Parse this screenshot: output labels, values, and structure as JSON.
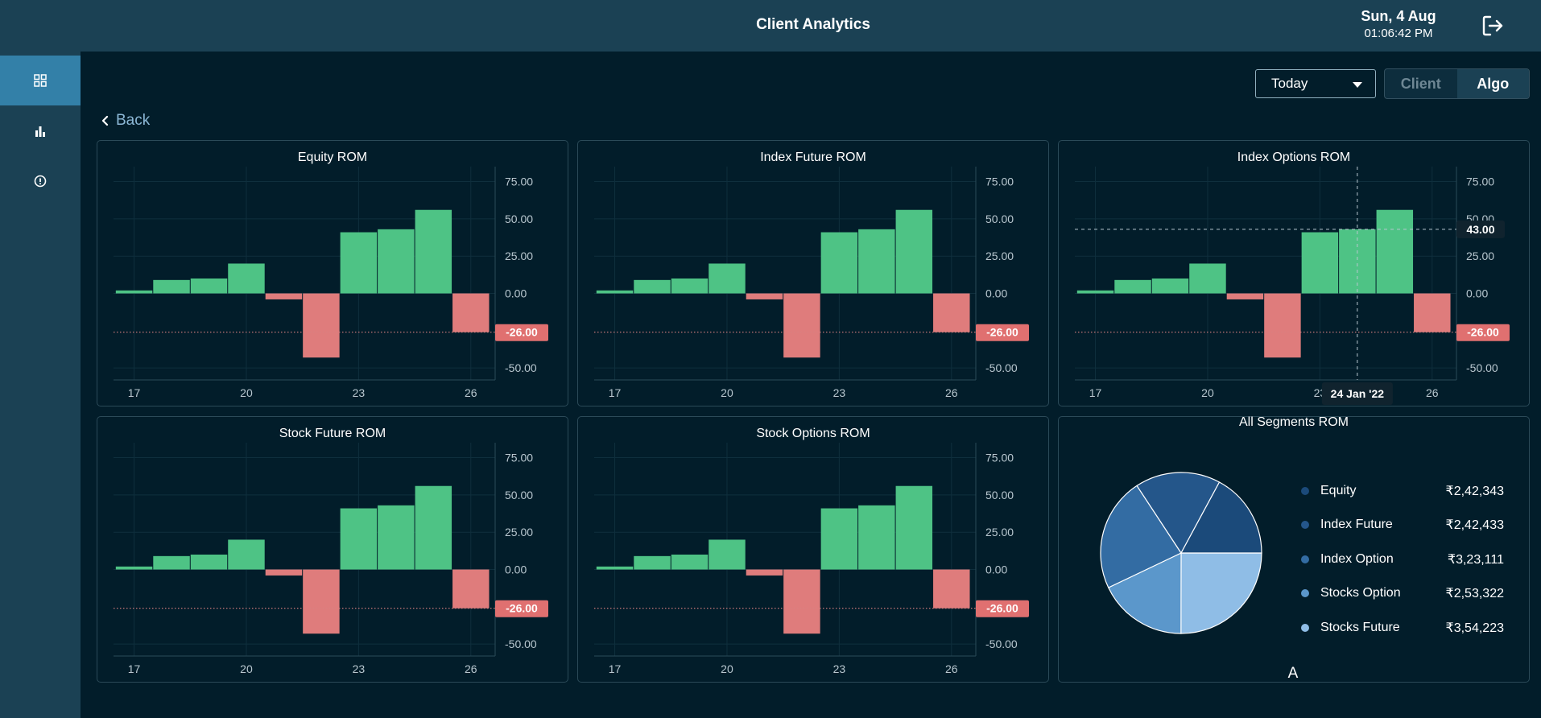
{
  "header": {
    "title": "Client Analytics",
    "date": "Sun, 4 Aug",
    "time": "01:06:42 PM"
  },
  "icons": {
    "logout": "logout-icon",
    "dashboard": "grid-icon",
    "reports": "bar-chart-icon",
    "info": "info-circle-icon",
    "back": "chevron-left-icon",
    "dropdown": "caret-down-icon"
  },
  "sidebar": {
    "items": [
      {
        "name": "dashboard",
        "active": true
      },
      {
        "name": "reports",
        "active": false
      },
      {
        "name": "info",
        "active": false
      }
    ]
  },
  "filters": {
    "period": "Today",
    "toggle": {
      "options": [
        "Client",
        "Algo"
      ],
      "selected": "Algo"
    }
  },
  "nav": {
    "back_label": "Back"
  },
  "colors": {
    "positive": "#4ec385",
    "negative": "#df7c7c",
    "reference_label_bg": "#e07070",
    "grid": "#0f2f3d"
  },
  "chart_data": [
    {
      "type": "bar",
      "title": "Equity ROM",
      "x": [
        17,
        18,
        19,
        20,
        21,
        22,
        23,
        24,
        25,
        26
      ],
      "values": [
        2,
        9,
        10,
        20,
        -4,
        -43,
        41,
        43,
        56,
        -26
      ],
      "xticks": [
        "17",
        "20",
        "23",
        "26"
      ],
      "yticks": [
        "75.00",
        "50.00",
        "25.00",
        "0.00",
        "-50.00"
      ],
      "ylim": [
        -58,
        85
      ],
      "reference_line": {
        "value": -26,
        "label": "-26.00"
      }
    },
    {
      "type": "bar",
      "title": "Index Future ROM",
      "x": [
        17,
        18,
        19,
        20,
        21,
        22,
        23,
        24,
        25,
        26
      ],
      "values": [
        2,
        9,
        10,
        20,
        -4,
        -43,
        41,
        43,
        56,
        -26
      ],
      "xticks": [
        "17",
        "20",
        "23",
        "26"
      ],
      "yticks": [
        "75.00",
        "50.00",
        "25.00",
        "0.00",
        "-50.00"
      ],
      "ylim": [
        -58,
        85
      ],
      "reference_line": {
        "value": -26,
        "label": "-26.00"
      }
    },
    {
      "type": "bar",
      "title": "Index Options ROM",
      "x": [
        17,
        18,
        19,
        20,
        21,
        22,
        23,
        24,
        25,
        26
      ],
      "values": [
        2,
        9,
        10,
        20,
        -4,
        -43,
        41,
        43,
        56,
        -26
      ],
      "xticks": [
        "17",
        "20",
        "23",
        "26"
      ],
      "yticks": [
        "75.00",
        "50.00",
        "25.00",
        "0.00",
        "-50.00"
      ],
      "ylim": [
        -58,
        85
      ],
      "reference_line": {
        "value": -26,
        "label": "-26.00"
      },
      "crosshair": {
        "x": 24,
        "y_label": "43.00",
        "x_label": "24 Jan '22"
      }
    },
    {
      "type": "bar",
      "title": "Stock Future ROM",
      "x": [
        17,
        18,
        19,
        20,
        21,
        22,
        23,
        24,
        25,
        26
      ],
      "values": [
        2,
        9,
        10,
        20,
        -4,
        -43,
        41,
        43,
        56,
        -26
      ],
      "xticks": [
        "17",
        "20",
        "23",
        "26"
      ],
      "yticks": [
        "75.00",
        "50.00",
        "25.00",
        "0.00",
        "-50.00"
      ],
      "ylim": [
        -58,
        85
      ],
      "reference_line": {
        "value": -26,
        "label": "-26.00"
      }
    },
    {
      "type": "bar",
      "title": "Stock Options ROM",
      "x": [
        17,
        18,
        19,
        20,
        21,
        22,
        23,
        24,
        25,
        26
      ],
      "values": [
        2,
        9,
        10,
        20,
        -4,
        -43,
        41,
        43,
        56,
        -26
      ],
      "xticks": [
        "17",
        "20",
        "23",
        "26"
      ],
      "yticks": [
        "75.00",
        "50.00",
        "25.00",
        "0.00",
        "-50.00"
      ],
      "ylim": [
        -58,
        85
      ],
      "reference_line": {
        "value": -26,
        "label": "-26.00"
      }
    },
    {
      "type": "pie",
      "title": "All Segments ROM",
      "footer": "A",
      "slices": [
        {
          "name": "Equity",
          "value": 242343,
          "display": "₹2,42,343",
          "color": "#1b4a7a"
        },
        {
          "name": "Index Future",
          "value": 242433,
          "display": "₹2,42,433",
          "color": "#24568a"
        },
        {
          "name": "Index Option",
          "value": 323111,
          "display": "₹3,23,111",
          "color": "#336ca3"
        },
        {
          "name": "Stocks Option",
          "value": 253322,
          "display": "₹2,53,322",
          "color": "#5b97cb"
        },
        {
          "name": "Stocks Future",
          "value": 354223,
          "display": "₹3,54,223",
          "color": "#8fbde6"
        }
      ]
    }
  ]
}
